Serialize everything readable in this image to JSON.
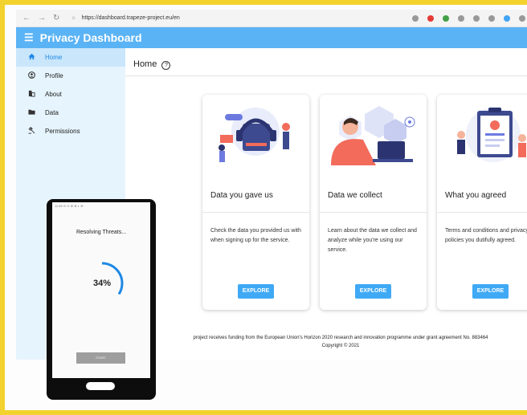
{
  "browser": {
    "url": "https://dashboard.trapeze-project.eu/en",
    "back_icon": "arrow-left-icon",
    "forward_icon": "arrow-right-icon",
    "reload_icon": "reload-icon",
    "extension_colors": [
      "#999999",
      "#e53935",
      "#43a047",
      "#999999",
      "#999999",
      "#999999",
      "#42a5f5",
      "#999999"
    ]
  },
  "app": {
    "title": "Privacy Dashboard",
    "menu_icon": "hamburger-menu-icon",
    "accent": "#5ab3f5"
  },
  "sidebar": {
    "items": [
      {
        "label": "Home",
        "icon": "home-icon",
        "active": true
      },
      {
        "label": "Profile",
        "icon": "account-circle-icon",
        "active": false
      },
      {
        "label": "About",
        "icon": "building-icon",
        "active": false
      },
      {
        "label": "Data",
        "icon": "folder-icon",
        "active": false
      },
      {
        "label": "Permissions",
        "icon": "gavel-icon",
        "active": false
      }
    ]
  },
  "main": {
    "title": "Home",
    "help_icon": "question-circle-icon",
    "help_glyph": "?",
    "cards": [
      {
        "title": "Data you gave us",
        "text": "Check the data you provided us with when signing up for the service.",
        "button": "EXPLORE"
      },
      {
        "title": "Data we collect",
        "text": "Learn about the data we collect and analyze while you're using our service.",
        "button": "EXPLORE"
      },
      {
        "title": "What you agreed",
        "text": "Terms and conditions and privacy policies you dutifully agreed.",
        "button": "EXPLORE"
      }
    ],
    "footer_line1": "project receives funding from the European Union's Horizon 2020 research and innovation programme under grant agreement No. 883464",
    "footer_line2": "Copyright © 2021"
  },
  "phone": {
    "status_text": "11:59 ⊙ ⊙ ⊕ ⊗ ◐ ⊚ ·",
    "heading": "Resolving Threats...",
    "progress_percent": 34,
    "progress_label": "34%",
    "start_button": "START",
    "progress_color": "#1e88e5"
  }
}
